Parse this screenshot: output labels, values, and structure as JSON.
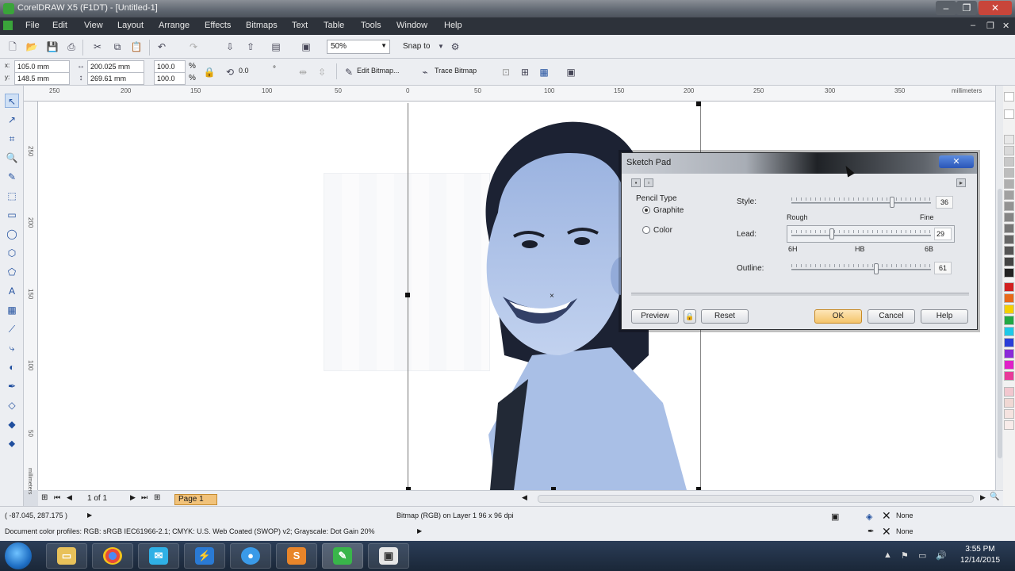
{
  "window": {
    "title": "CorelDRAW X5 (F1DT) - [Untitled-1]",
    "controls": [
      "–",
      "❐",
      "✕"
    ]
  },
  "menu": {
    "items": [
      "File",
      "Edit",
      "View",
      "Layout",
      "Arrange",
      "Effects",
      "Bitmaps",
      "Text",
      "Table",
      "Tools",
      "Window",
      "Help"
    ]
  },
  "toolbar": {
    "zoom": "50%",
    "snap_to": "Snap to"
  },
  "property_bar": {
    "x": "105.0 mm",
    "y": "148.5 mm",
    "width": "200.025 mm",
    "height": "269.61 mm",
    "scale_w": "100.0",
    "scale_h": "100.0",
    "percent": "%",
    "rotation": "0.0",
    "degree": "°",
    "edit_bitmap": "Edit Bitmap...",
    "trace_bitmap": "Trace Bitmap"
  },
  "ruler": {
    "top_ticks": [
      "250",
      "200",
      "150",
      "100",
      "50",
      "0",
      "50",
      "100",
      "150",
      "200",
      "250",
      "300",
      "350"
    ],
    "unit": "millimeters",
    "left_ticks": [
      "250",
      "200",
      "150",
      "100",
      "50"
    ],
    "left_unit": "millimeters"
  },
  "pages": {
    "counter": "1 of 1",
    "tab": "Page 1"
  },
  "status": {
    "coords": "( -87.045, 287.175 )",
    "object_info": "Bitmap (RGB) on Layer 1 96 x 96 dpi",
    "color_profiles": "Document color profiles: RGB: sRGB IEC61966-2.1; CMYK: U.S. Web Coated (SWOP) v2; Grayscale: Dot Gain 20%",
    "fill_none": "None",
    "outline_none": "None"
  },
  "dialog": {
    "title": "Sketch Pad",
    "pencil_type_label": "Pencil Type",
    "options": [
      "Graphite",
      "Color"
    ],
    "selected": "Graphite",
    "style_label": "Style:",
    "style_value": "36",
    "style_level": 0.72,
    "style_min_label": "Rough",
    "style_max_label": "Fine",
    "lead_label": "Lead:",
    "lead_value": "29",
    "lead_level": 0.29,
    "lead_ticks": [
      "6H",
      "HB",
      "6B"
    ],
    "outline_label": "Outline:",
    "outline_value": "61",
    "outline_level": 0.61,
    "buttons": {
      "preview": "Preview",
      "reset": "Reset",
      "ok": "OK",
      "cancel": "Cancel",
      "help": "Help"
    }
  },
  "taskbar": {
    "time": "3:55 PM",
    "date": "12/14/2015"
  },
  "colors": {
    "accent": "#3aa43a",
    "photo_tint": "#8ea8d8",
    "ok_button": "#f4c46b"
  }
}
